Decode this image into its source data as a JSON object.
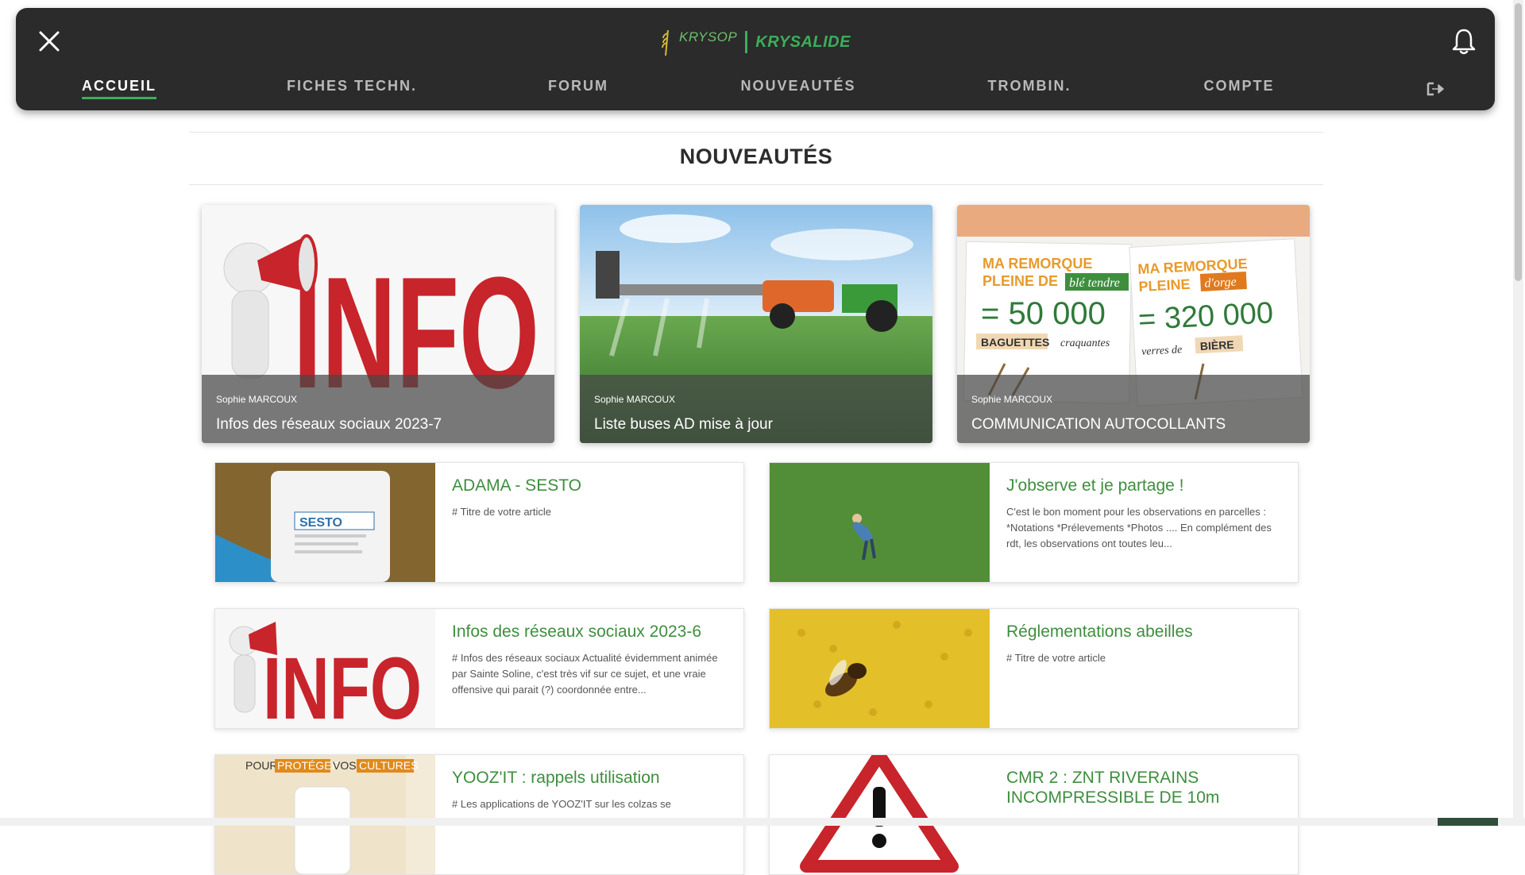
{
  "brand": {
    "left": "KRYSOP",
    "right": "KRYSALIDE"
  },
  "nav": {
    "items": [
      {
        "label": "ACCUEIL",
        "active": true
      },
      {
        "label": "FICHES TECHN.",
        "active": false
      },
      {
        "label": "FORUM",
        "active": false
      },
      {
        "label": "NOUVEAUTÉS",
        "active": false
      },
      {
        "label": "TROMBIN.",
        "active": false
      },
      {
        "label": "COMPTE",
        "active": false
      }
    ]
  },
  "section": {
    "title": "NOUVEAUTÉS"
  },
  "featured": [
    {
      "author": "Sophie MARCOUX",
      "title": "Infos des réseaux sociaux 2023-7",
      "image_text": "INFO"
    },
    {
      "author": "Sophie MARCOUX",
      "title": "Liste buses AD mise à jour"
    },
    {
      "author": "Sophie MARCOUX",
      "title": "COMMUNICATION AUTOCOLLANTS",
      "poster": {
        "left_line1": "MA REMORQUE",
        "left_line2": "PLEINE DE",
        "left_tag": "blé tendre",
        "left_value": "= 50 000",
        "left_unit": "BAGUETTES",
        "left_unit2": "craquantes",
        "right_line1": "MA REMORQUE",
        "right_line2": "PLEINE",
        "right_tag": "d'orge",
        "right_value": "= 320 000",
        "right_unit": "verres de",
        "right_unit2": "BIÈRE"
      }
    }
  ],
  "articles": [
    {
      "title": "ADAMA - SESTO",
      "excerpt": "# Titre de votre article",
      "image_text": "SESTO"
    },
    {
      "title": "J'observe et je partage !",
      "excerpt": "C'est le bon moment pour les observations en parcelles : *Notations *Prélevements *Photos .... En complément des rdt, les observations ont toutes leu..."
    },
    {
      "title": "Infos des réseaux sociaux 2023-6",
      "excerpt": "# Infos des réseaux sociaux Actualité évidemment animée par Sainte Soline, c'est très vif sur ce sujet, et une vraie offensive qui parait (?) coordonnée entre...",
      "image_text": "INFO"
    },
    {
      "title": "Réglementations abeilles",
      "excerpt": "# Titre de votre article"
    },
    {
      "title": "YOOZ'IT : rappels utilisation",
      "excerpt": "# Les applications de YOOZ'IT sur les colzas se",
      "banner": {
        "w1": "POUR",
        "w2": "PROTÉGER",
        "w3": "VOS",
        "w4": "CULTURES"
      }
    },
    {
      "title": "CMR 2 : ZNT RIVERAINS INCOMPRESSIBLE DE 10m",
      "excerpt": ""
    }
  ],
  "colors": {
    "accent": "#3cae5a",
    "nav_bg": "#2b2b2b",
    "title_green": "#3e8e3e"
  }
}
